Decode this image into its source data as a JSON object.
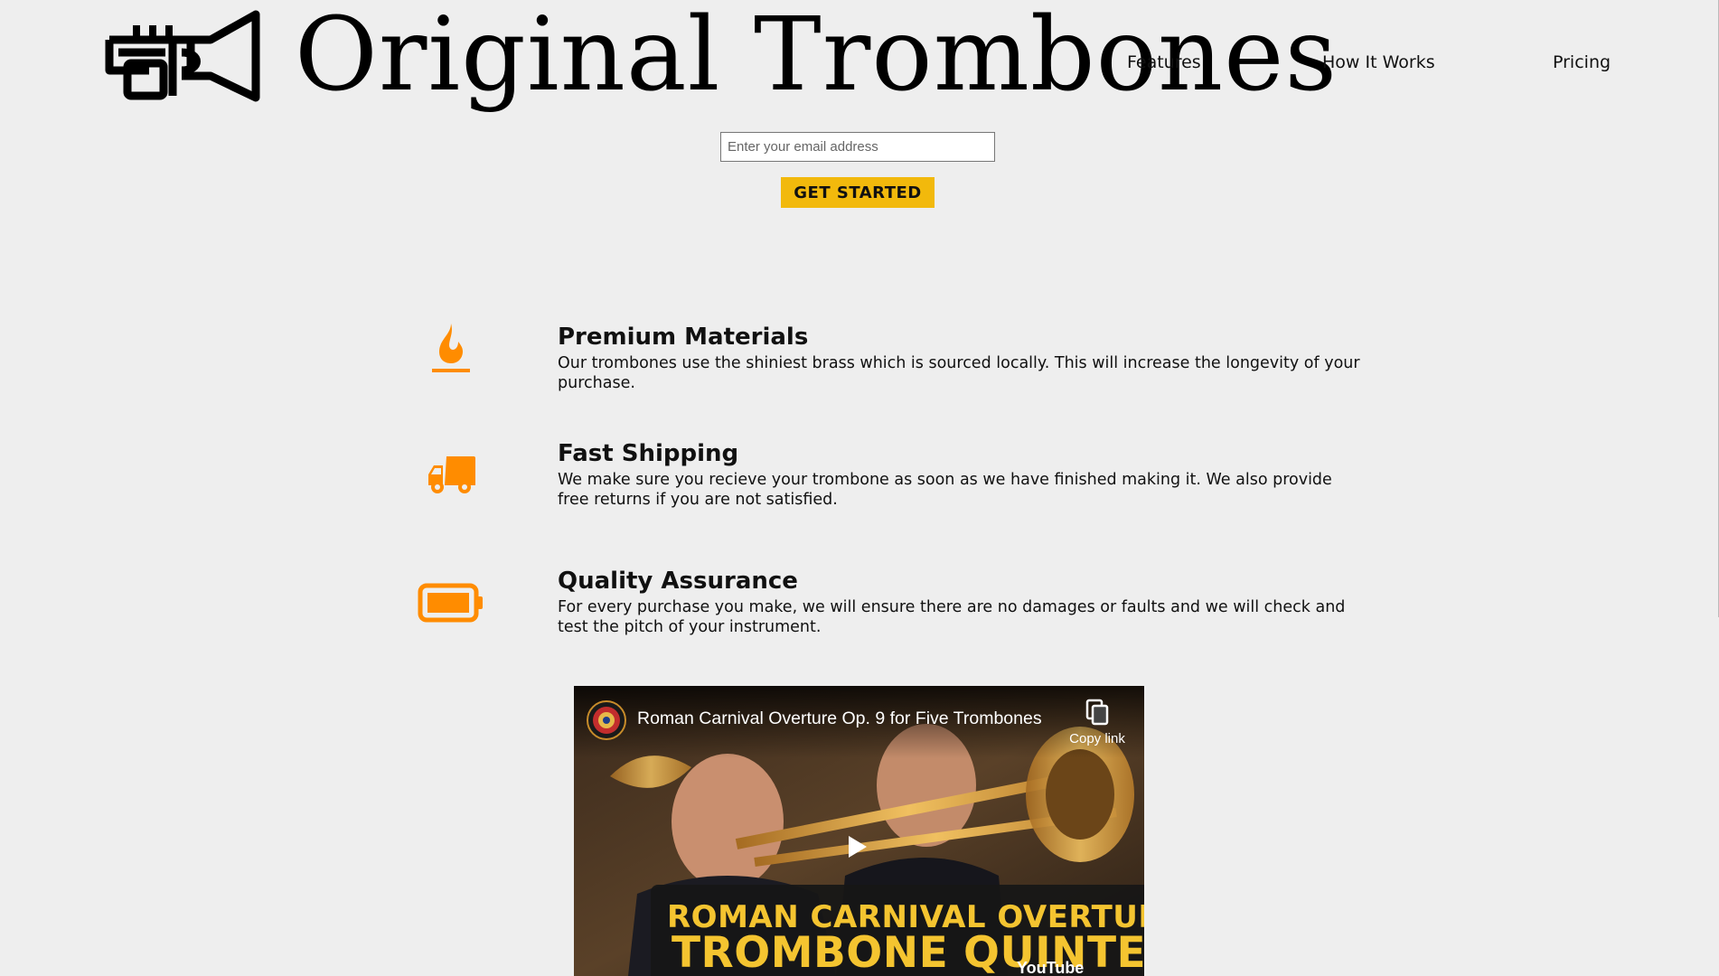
{
  "header": {
    "brand": "Original Trombones",
    "logo_icon": "trumpet-icon",
    "nav": [
      {
        "label": "Features"
      },
      {
        "label": "How It Works"
      },
      {
        "label": "Pricing"
      }
    ]
  },
  "form": {
    "email_placeholder": "Enter your email address",
    "submit_label": "GET STARTED"
  },
  "features": [
    {
      "icon": "fire-icon",
      "title": "Premium Materials",
      "desc": "Our trombones use the shiniest brass which is sourced locally. This will increase the longevity of your purchase."
    },
    {
      "icon": "truck-icon",
      "title": "Fast Shipping",
      "desc": "We make sure you recieve your trombone as soon as we have finished making it. We also provide free returns if you are not satisfied."
    },
    {
      "icon": "battery-icon",
      "title": "Quality Assurance",
      "desc": "For every purchase you make, we will ensure there are no damages or faults and we will check and test the pitch of your instrument."
    }
  ],
  "video": {
    "title": "Roman Carnival Overture Op. 9 for Five Trombones",
    "copy_link_label": "Copy link",
    "banner_line1": "ROMAN CARNIVAL OVERTURE",
    "banner_line2": "TROMBONE QUINTET",
    "watermark": "YouTube"
  },
  "colors": {
    "background": "#eeeeee",
    "accent": "#f2b90c",
    "icon_orange": "#ff8c00"
  }
}
